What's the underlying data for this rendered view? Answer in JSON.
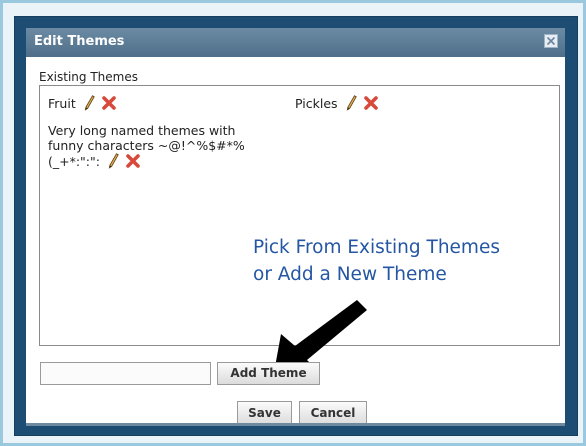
{
  "dialog": {
    "title": "Edit Themes",
    "close_icon": "close-icon"
  },
  "existing": {
    "label": "Existing Themes",
    "themes": [
      {
        "name": "Fruit",
        "edit_icon": "pencil-icon",
        "delete_icon": "delete-x-icon"
      },
      {
        "name": "Pickles",
        "edit_icon": "pencil-icon",
        "delete_icon": "delete-x-icon"
      },
      {
        "name": "Very long named themes with\nfunny characters ~@!^%$#*%\n(_+*:\":\":",
        "edit_icon": "pencil-icon",
        "delete_icon": "delete-x-icon"
      }
    ]
  },
  "annotation": {
    "line1": "Pick From Existing Themes",
    "line2": "or Add a New Theme",
    "arrow_icon": "arrow-down-left-icon",
    "color": "#2456a4"
  },
  "new_theme": {
    "value": "",
    "placeholder": "",
    "add_label": "Add Theme"
  },
  "actions": {
    "save_label": "Save",
    "cancel_label": "Cancel"
  },
  "colors": {
    "titlebar": "#5a7891",
    "frame": "#1d4d73",
    "delete": "#d9493a"
  }
}
